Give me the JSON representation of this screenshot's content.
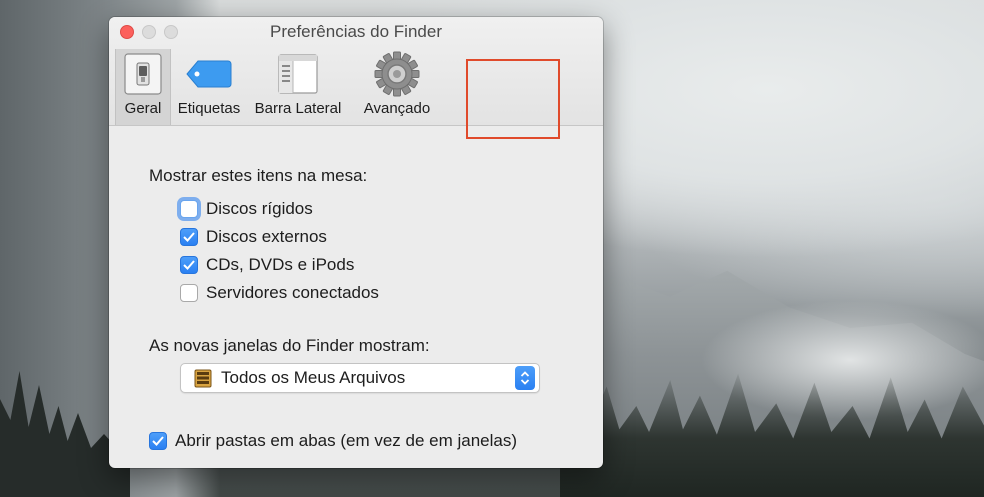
{
  "window": {
    "title": "Preferências do Finder"
  },
  "toolbar": {
    "items": [
      {
        "label": "Geral",
        "icon": "switch-icon",
        "active": true
      },
      {
        "label": "Etiquetas",
        "icon": "tag-icon",
        "active": false
      },
      {
        "label": "Barra Lateral",
        "icon": "sidebar-icon",
        "active": false
      },
      {
        "label": "Avançado",
        "icon": "gear-icon",
        "active": false
      }
    ],
    "highlight_color": "#e04a2b"
  },
  "desktop_section": {
    "heading": "Mostrar estes itens na mesa:",
    "items": [
      {
        "label": "Discos rígidos",
        "checked": false,
        "focused": true
      },
      {
        "label": "Discos externos",
        "checked": true
      },
      {
        "label": "CDs, DVDs e iPods",
        "checked": true
      },
      {
        "label": "Servidores conectados",
        "checked": false
      }
    ]
  },
  "new_windows_section": {
    "heading": "As novas janelas do Finder mostram:",
    "selected": "Todos os Meus Arquivos",
    "icon": "all-files-icon"
  },
  "tabs_option": {
    "label": "Abrir pastas em abas (em vez de em janelas)",
    "checked": true
  },
  "colors": {
    "accent": "#2a80f2",
    "close": "#fc605c"
  }
}
